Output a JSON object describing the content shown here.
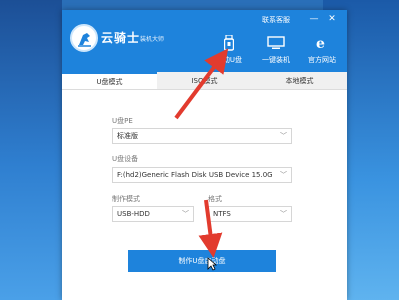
{
  "app": {
    "name": "云骑士",
    "subtitle": "装机大师"
  },
  "titlebar": {
    "link": "联系客服",
    "minimize_glyph": "—",
    "close_glyph": "✕"
  },
  "toolbar": [
    {
      "label": "启动U盘",
      "icon": "usb-drive-icon"
    },
    {
      "label": "一键装机",
      "icon": "monitor-icon"
    },
    {
      "label": "官方网站",
      "icon": "ie-browser-icon"
    }
  ],
  "tabs": [
    "U盘模式",
    "ISO模式",
    "本地模式"
  ],
  "form": {
    "pe_label": "U盘PE",
    "pe_value": "标准版",
    "device_label": "U盘设备",
    "device_value": "F:(hd2)Generic Flash Disk USB Device 15.0G",
    "mode_label": "制作模式",
    "mode_value": "USB-HDD",
    "format_label": "格式",
    "format_value": "NTFS"
  },
  "action": {
    "make_label": "制作U盘启动盘"
  },
  "colors": {
    "accent": "#1e83dc",
    "annotation_arrow": "#e23b2e"
  }
}
